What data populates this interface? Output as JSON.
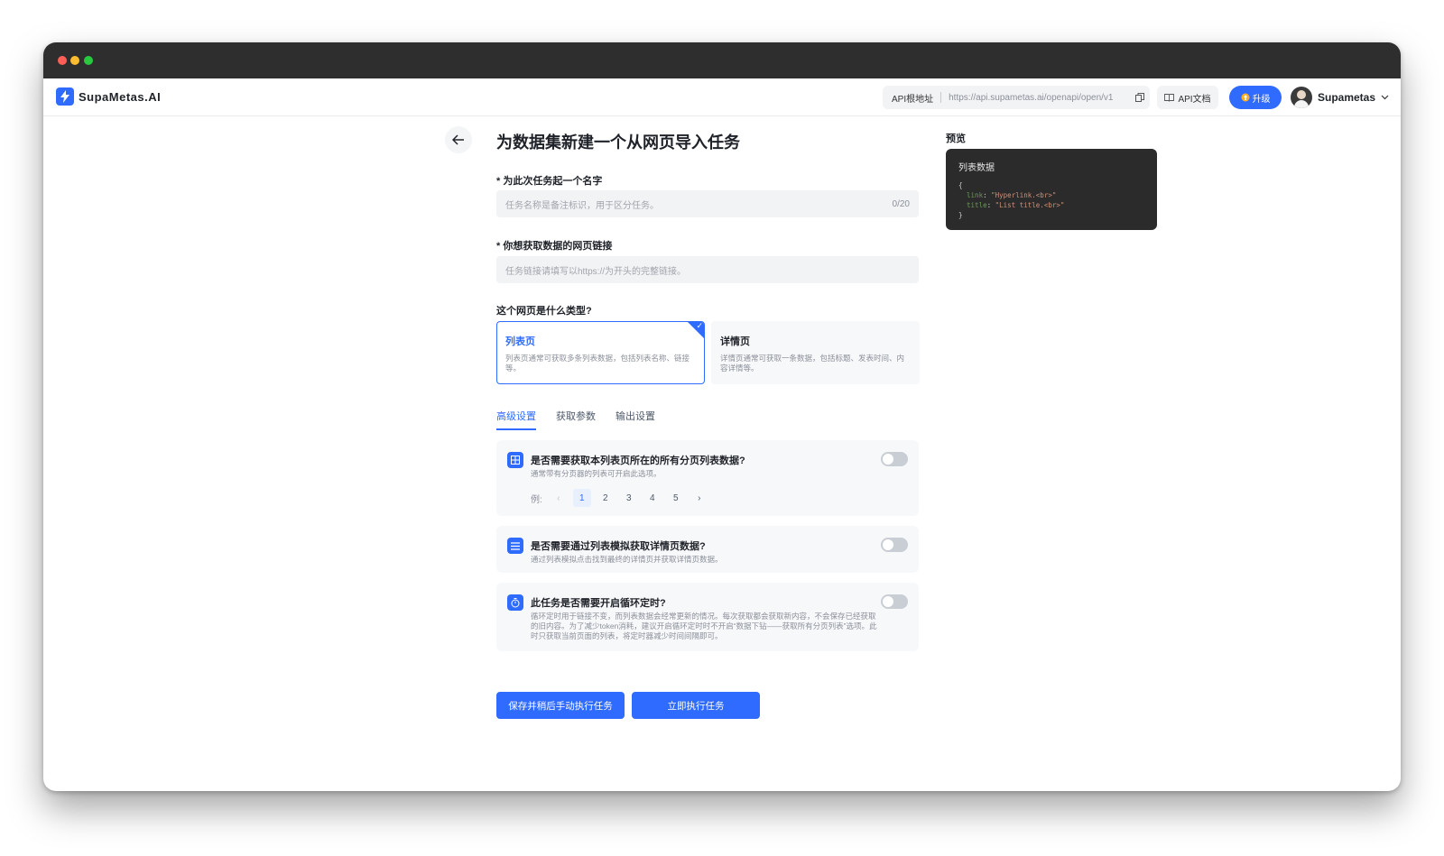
{
  "app": {
    "name": "SupaMetas.AI"
  },
  "header": {
    "api_label": "API根地址",
    "api_url": "https://api.supametas.ai/openapi/open/v1",
    "docs_label": "API文档",
    "upgrade_label": "升级",
    "user_name": "Supametas"
  },
  "page": {
    "title": "为数据集新建一个从网页导入任务"
  },
  "form": {
    "name_label": "* 为此次任务起一个名字",
    "name_placeholder": "任务名称是备注标识，用于区分任务。",
    "name_count": "0/20",
    "url_label": "* 你想获取数据的网页链接",
    "url_placeholder": "任务链接请填写以https://为开头的完整链接。",
    "type_label": "这个网页是什么类型?",
    "types": [
      {
        "title": "列表页",
        "desc": "列表页通常可获取多条列表数据，包括列表名称、链接等。",
        "selected": true
      },
      {
        "title": "详情页",
        "desc": "详情页通常可获取一条数据，包括标题、发表时间、内容详情等。",
        "selected": false
      }
    ]
  },
  "tabs": [
    {
      "label": "高级设置",
      "active": true
    },
    {
      "label": "获取参数",
      "active": false
    },
    {
      "label": "输出设置",
      "active": false
    }
  ],
  "options": [
    {
      "title": "是否需要获取本列表页所在的所有分页列表数据?",
      "desc": "通常带有分页器的列表可开启此选项。",
      "enabled": false,
      "example_label": "例:",
      "pages": [
        "1",
        "2",
        "3",
        "4",
        "5"
      ],
      "current_page": "1"
    },
    {
      "title": "是否需要通过列表模拟获取详情页数据?",
      "desc": "通过列表模拟点击找到最终的详情页并获取详情页数据。",
      "enabled": false
    },
    {
      "title": "此任务是否需要开启循环定时?",
      "desc": "循环定时用于链接不变，而列表数据会经常更新的情况。每次获取都会获取新内容，不会保存已经获取的旧内容。为了减少token消耗，建议开启循环定时时不开启“数据下钻——获取所有分页列表”选项。此时只获取当前页面的列表，将定时器减少时间间隔即可。",
      "enabled": false
    }
  ],
  "actions": {
    "save_label": "保存并稍后手动执行任务",
    "run_label": "立即执行任务"
  },
  "preview": {
    "label": "预览",
    "title": "列表数据",
    "code_open": "{",
    "code_line1_key": "link",
    "code_line1_val": "\"Hyperlink.<br>\"",
    "code_line2_key": "title",
    "code_line2_val": "\"List title.<br>\"",
    "code_close": "}"
  },
  "colors": {
    "accent": "#2f6bff",
    "titlebar": "#2e2e2e",
    "preview_bg": "#2b2b2b"
  }
}
